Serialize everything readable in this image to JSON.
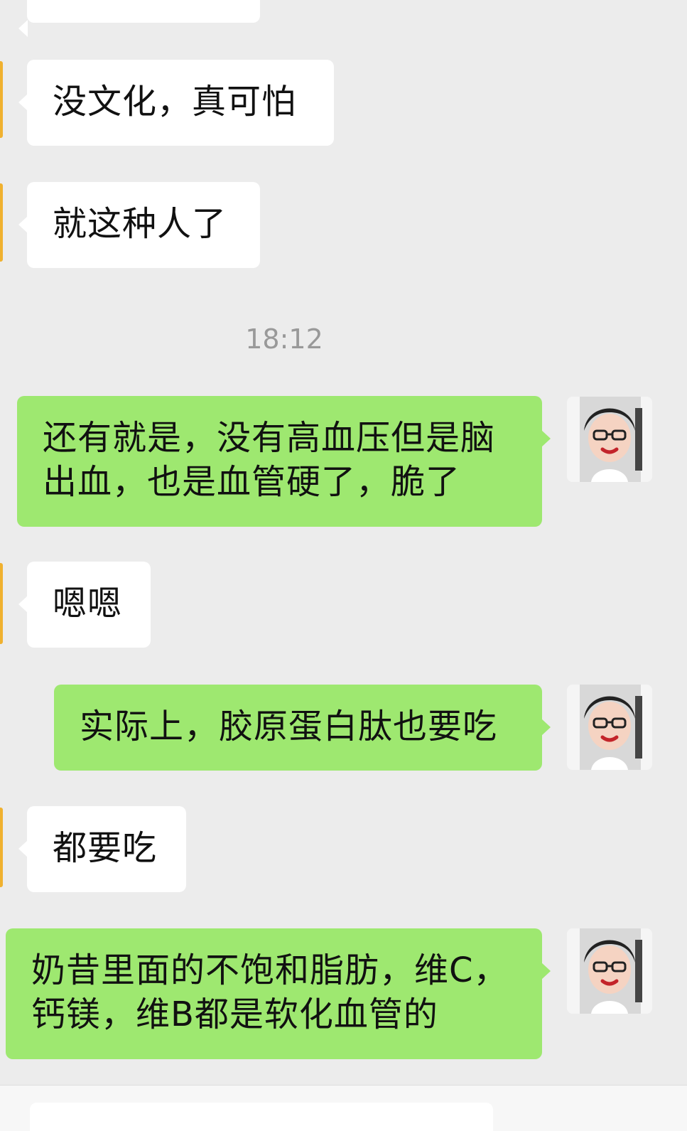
{
  "messages": [
    {
      "side": "in",
      "text": ""
    },
    {
      "side": "in",
      "text": "没文化，真可怕"
    },
    {
      "side": "in",
      "text": "就这种人了"
    },
    {
      "side": "time",
      "text": "18:12"
    },
    {
      "side": "out",
      "lines": [
        "还有就是，没有高血压但是脑",
        "出血，也是血管硬了，脆了"
      ]
    },
    {
      "side": "in",
      "text": "嗯嗯"
    },
    {
      "side": "out",
      "text": "实际上，胶原蛋白肽也要吃"
    },
    {
      "side": "in",
      "text": "都要吃"
    },
    {
      "side": "out",
      "lines": [
        "奶昔里面的不饱和脂肪，维C，",
        "钙镁，维B都是软化血管的"
      ]
    }
  ],
  "colors": {
    "background": "#ececec",
    "incoming_bubble": "#ffffff",
    "outgoing_bubble": "#9ee870",
    "timestamp": "#999999"
  },
  "icons": {
    "avatar": "user-avatar-icon"
  }
}
